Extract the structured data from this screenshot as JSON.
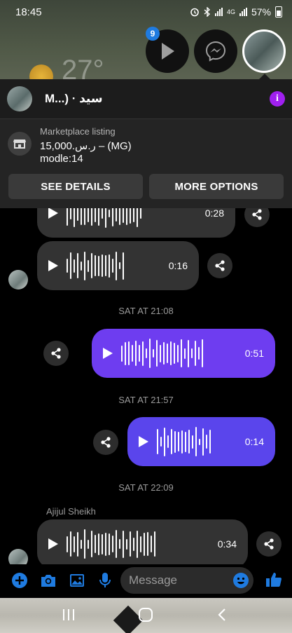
{
  "status_bar": {
    "time": "18:45",
    "network": "4G",
    "battery": "57%"
  },
  "wallpaper": {
    "temperature": "27°"
  },
  "chat_heads": {
    "badge_count": "9"
  },
  "conversation": {
    "title": "M...) · سيد"
  },
  "listing": {
    "label": "Marketplace listing",
    "price": "15,000.ر.س – (MG)",
    "model": "modle:14",
    "see_details": "SEE DETAILS",
    "more_options": "MORE OPTIONS"
  },
  "messages": [
    {
      "direction": "in",
      "duration": "0:28"
    },
    {
      "direction": "in",
      "duration": "0:16"
    },
    {
      "timestamp": "SAT AT 21:08"
    },
    {
      "direction": "out",
      "duration": "0:51"
    },
    {
      "timestamp": "SAT AT 21:57"
    },
    {
      "direction": "out",
      "duration": "0:14"
    },
    {
      "timestamp": "SAT AT 22:09"
    },
    {
      "sender": "Ajijul Sheikh",
      "direction": "in",
      "duration": "0:34"
    }
  ],
  "composer": {
    "placeholder": "Message"
  },
  "colors": {
    "accent_purple": "#6e3df0",
    "accent_blue": "#1f7be0",
    "info_purple": "#a020f0"
  },
  "icons": [
    "play-icon",
    "messenger-icon",
    "info-icon",
    "store-icon",
    "share-icon",
    "plus-icon",
    "camera-icon",
    "gallery-icon",
    "mic-icon",
    "emoji-icon",
    "like-icon",
    "recents-icon",
    "home-icon",
    "back-icon"
  ]
}
